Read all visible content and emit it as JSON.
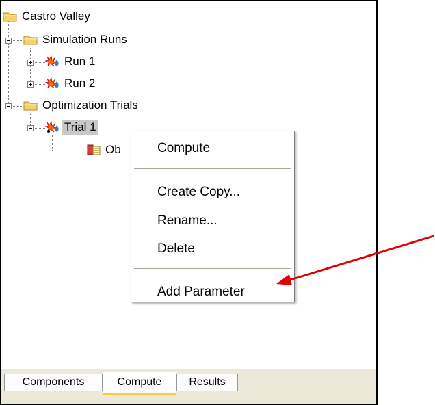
{
  "tree": {
    "root": "Castro Valley",
    "simulation_runs": "Simulation Runs",
    "run1": "Run 1",
    "run2": "Run 2",
    "optimization_trials": "Optimization Trials",
    "trial1": "Trial 1",
    "objective_partial": "Ob"
  },
  "context_menu": {
    "compute": "Compute",
    "create_copy": "Create Copy...",
    "rename": "Rename...",
    "delete": "Delete",
    "add_parameter": "Add Parameter"
  },
  "tabs": [
    "Components",
    "Compute",
    "Results"
  ],
  "active_tab": "Compute",
  "colors": {
    "annotation_arrow": "#e00000",
    "selection": "#c8c8c8",
    "active_tab_accent": "#ffc83c"
  }
}
